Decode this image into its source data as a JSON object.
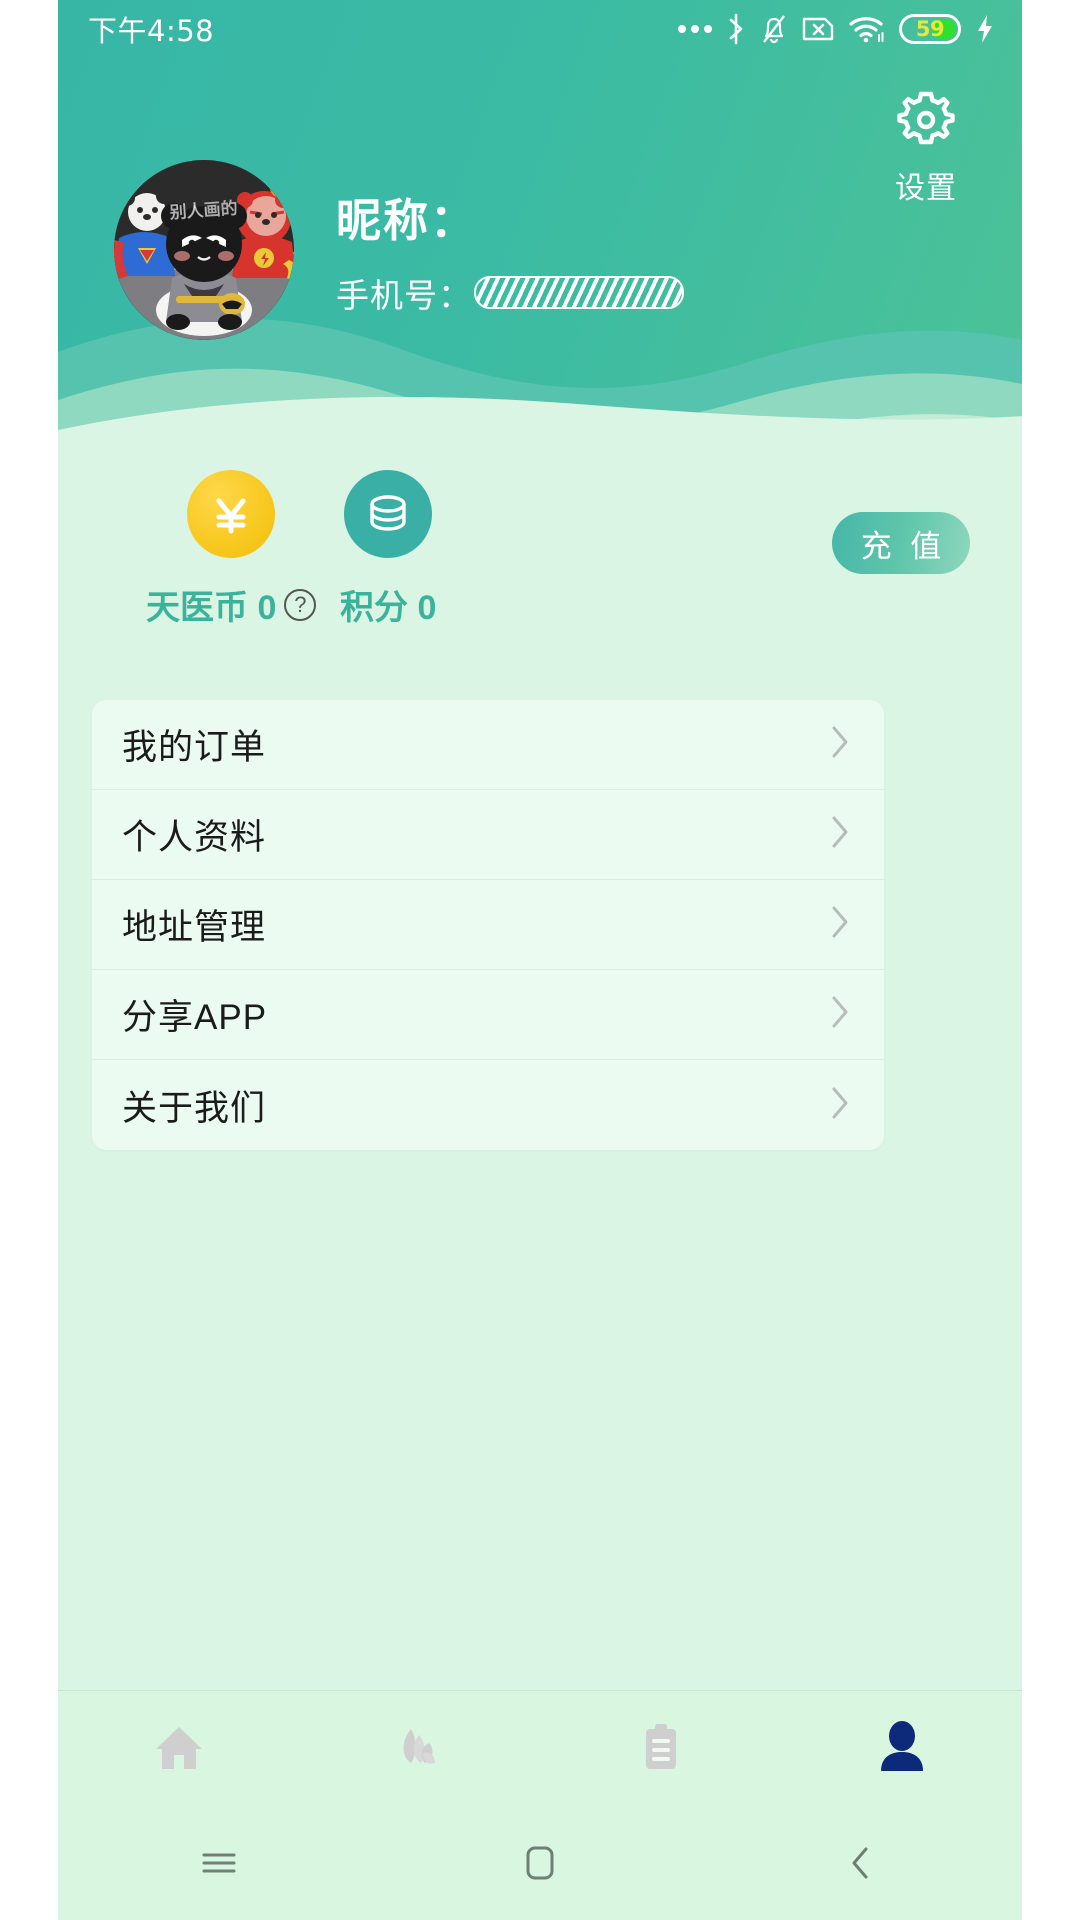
{
  "status_bar": {
    "time": "下午4:58",
    "icons": [
      "more-dots-icon",
      "bluetooth-icon",
      "silent-bell-icon",
      "sim-no-card-icon",
      "wifi-icon",
      "battery-icon",
      "charging-bolt-icon"
    ],
    "battery_percent": "59"
  },
  "header": {
    "settings_label": "设置",
    "settings_icon": "gear-icon",
    "gradient_start": "#37b6a6",
    "gradient_end": "#4cc297"
  },
  "profile": {
    "avatar_icon": "user-avatar-image",
    "avatar_watermark": "别人画的",
    "nickname_label": "昵称：",
    "phone_label": "手机号：",
    "phone_value_redacted": true
  },
  "wallet": {
    "coin": {
      "icon": "yen-coin-icon",
      "label": "天医币 0",
      "help_icon": "question-mark-icon",
      "color": "#f7c81f"
    },
    "points": {
      "icon": "stacked-coins-icon",
      "label": "积分 0",
      "color": "#3aafa5"
    },
    "recharge_button": "充 值"
  },
  "menu": {
    "items": [
      {
        "label": "我的订单",
        "name": "my-orders"
      },
      {
        "label": "个人资料",
        "name": "personal-info"
      },
      {
        "label": "地址管理",
        "name": "address-management"
      },
      {
        "label": "分享APP",
        "name": "share-app"
      },
      {
        "label": "关于我们",
        "name": "about-us"
      }
    ]
  },
  "tabbar": {
    "tabs": [
      {
        "icon": "home-icon",
        "active": false
      },
      {
        "icon": "herb-leaf-icon",
        "active": false
      },
      {
        "icon": "clipboard-icon",
        "active": false
      },
      {
        "icon": "person-icon",
        "active": true
      }
    ],
    "active_color": "#0d2a7a",
    "inactive_color": "#cfcfcf"
  },
  "navbar": {
    "buttons": [
      "recents-menu-icon",
      "home-square-icon",
      "back-chevron-icon"
    ]
  }
}
